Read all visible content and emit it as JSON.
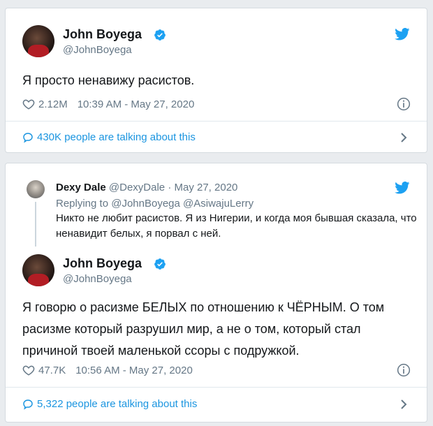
{
  "tweet1": {
    "author_name": "John Boyega",
    "author_handle": "@JohnBoyega",
    "text": "Я просто ненавижу расистов.",
    "likes": "2.12M",
    "timestamp": "10:39 AM - May 27, 2020",
    "talking": "430K people are talking about this"
  },
  "tweet2": {
    "reply_to_tweet": {
      "author_name": "Dexy Dale",
      "author_handle": "@DexyDale",
      "date": "· May 27, 2020",
      "replying_prefix": "Replying to",
      "replying_handles": "@JohnBoyega @AsiwajuLerry",
      "text": "Никто не любит расистов. Я из Нигерии, и когда моя бывшая сказала, что ненавидит белых, я порвал с ней."
    },
    "author_name": "John Boyega",
    "author_handle": "@JohnBoyega",
    "text": "Я говорю о расизме БЕЛЫХ по отношению к ЧЁРНЫМ. О том расизме который разрушил мир, а не о том, который стал причиной твоей маленькой ссоры с подружкой.",
    "likes": "47.7K",
    "timestamp": "10:56 AM - May 27, 2020",
    "talking": "5,322 people are talking about this"
  },
  "colors": {
    "twitter_blue": "#1da1f2",
    "link_blue": "#1b95e0",
    "gray_text": "#657786",
    "background": "#e9ecef"
  },
  "icons": [
    "twitter-bird-icon",
    "verified-badge-icon",
    "heart-icon",
    "info-icon",
    "speech-bubble-icon",
    "chevron-right-icon"
  ]
}
